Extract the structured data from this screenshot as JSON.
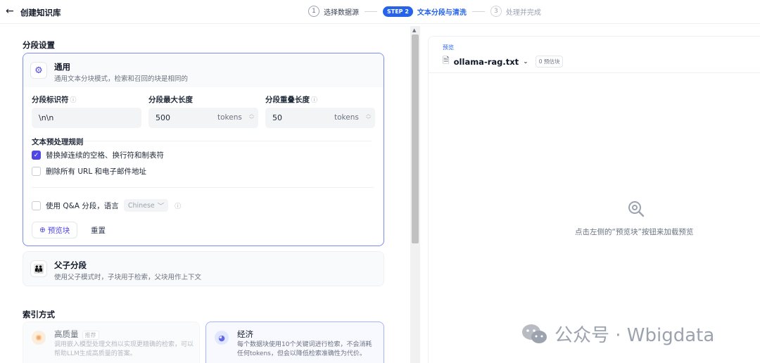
{
  "header": {
    "back_icon": "arrow-left-icon",
    "title": "创建知识库",
    "steps": [
      {
        "num": "1",
        "label": "选择数据源"
      },
      {
        "pill": "STEP 2",
        "label": "文本分段与清洗"
      },
      {
        "num": "3",
        "label": "处理并完成"
      }
    ]
  },
  "segment": {
    "section_title": "分段设置",
    "general": {
      "icon": "gear-icon",
      "name": "通用",
      "desc": "通用文本分块模式，检索和召回的块是相同的",
      "separator_label": "分段标识符",
      "separator_value": "\\n\\n",
      "max_len_label": "分段最大长度",
      "max_len_value": "500",
      "max_len_unit": "tokens",
      "overlap_label": "分段重叠长度",
      "overlap_value": "50",
      "overlap_unit": "tokens",
      "rules_title": "文本预处理规则",
      "rule1": "替换掉连续的空格、换行符和制表符",
      "rule1_checked": true,
      "rule2": "删除所有 URL 和电子邮件地址",
      "rule2_checked": false,
      "qa_label": "使用 Q&A 分段，语言",
      "qa_lang": "Chinese",
      "preview_button": "预览块",
      "reset_button": "重置"
    },
    "parent_child": {
      "icon": "parent-child-icon",
      "name": "父子分段",
      "desc": "使用父子模式时，子块用于检索，父块用作上下文"
    }
  },
  "index": {
    "section_title": "索引方式",
    "high": {
      "name": "高质量",
      "badge": "推荐",
      "desc": "调用嵌入模型处理文档以实现更精确的检索，可以帮助LLM生成高质量的答案。"
    },
    "eco": {
      "name": "经济",
      "desc": "每个数据块使用10个关键词进行检索，不会消耗任何tokens，但会以降低检索准确性为代价。"
    }
  },
  "preview": {
    "small_label": "预览",
    "file_name": "ollama-rag.txt",
    "est_badge": "0 预估块",
    "empty_text": "点击左侧的“预览块”按钮来加载预览"
  },
  "watermark": {
    "text": "公众号 · Wbigdata"
  },
  "colors": {
    "accent": "#4f46e5",
    "step_active": "#2563eb"
  }
}
